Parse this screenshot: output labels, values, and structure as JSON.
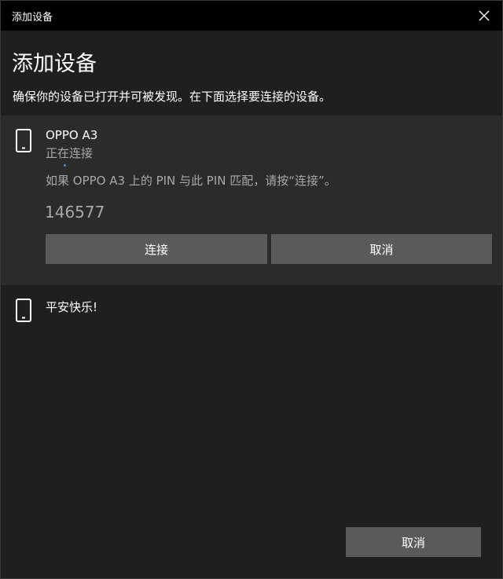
{
  "window": {
    "title": "添加设备"
  },
  "header": {
    "title": "添加设备",
    "instruction": "确保你的设备已打开并可被发现。在下面选择要连接的设备。"
  },
  "devices": [
    {
      "name": "OPPO A3",
      "status": "正在连接",
      "pin_message": "如果 OPPO A3 上的 PIN 与此 PIN 匹配，请按“连接”。",
      "pin": "146577",
      "connect_label": "连接",
      "cancel_label": "取消",
      "icon": "phone-icon"
    },
    {
      "name": "平安快乐!",
      "icon": "phone-icon"
    }
  ],
  "footer": {
    "cancel_label": "取消"
  },
  "colors": {
    "background": "#1f1f1f",
    "titlebar": "#000000",
    "panel": "#2b2b2b",
    "button": "#5a5a5a",
    "secondary_text": "#a8a8a8",
    "accent": "#3a8ee6"
  }
}
